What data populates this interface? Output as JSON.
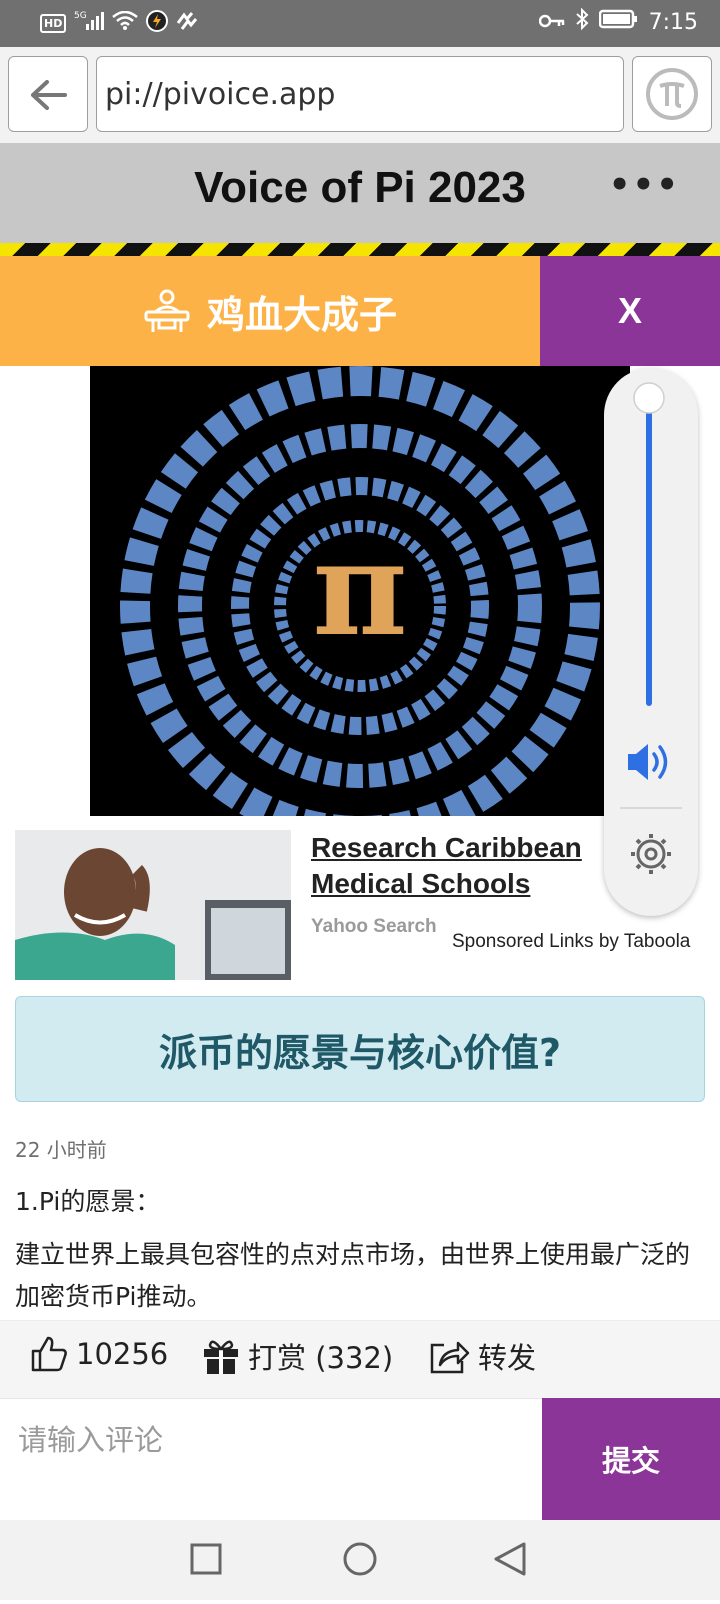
{
  "status_bar": {
    "hd": "HD",
    "network": "5G",
    "time": "7:15"
  },
  "browser": {
    "url": "pi://pivoice.app"
  },
  "header": {
    "title": "Voice of Pi 2023",
    "more": "•••"
  },
  "banner": {
    "label": "鸡血大成子",
    "close": "X"
  },
  "volume": {
    "level": 1.0
  },
  "ad": {
    "title": "Research Caribbean Medical Schools",
    "source": "Yahoo Search",
    "sponsor": "Sponsored Links by Taboola"
  },
  "article": {
    "question": "派币的愿景与核心价值?",
    "time_ago": "22 小时前",
    "paragraph1": "1.Pi的愿景：",
    "paragraph2": "建立世界上最具包容性的点对点市场，由世界上使用最广泛的加密货币Pi推动。"
  },
  "actions": {
    "likes": "10256",
    "reward": "打赏 (332)",
    "share": "转发"
  },
  "comment": {
    "placeholder": "请输入评论",
    "submit": "提交"
  },
  "colors": {
    "purple": "#8c3599",
    "orange": "#fdb247",
    "volume_blue": "#2f6fe4"
  }
}
